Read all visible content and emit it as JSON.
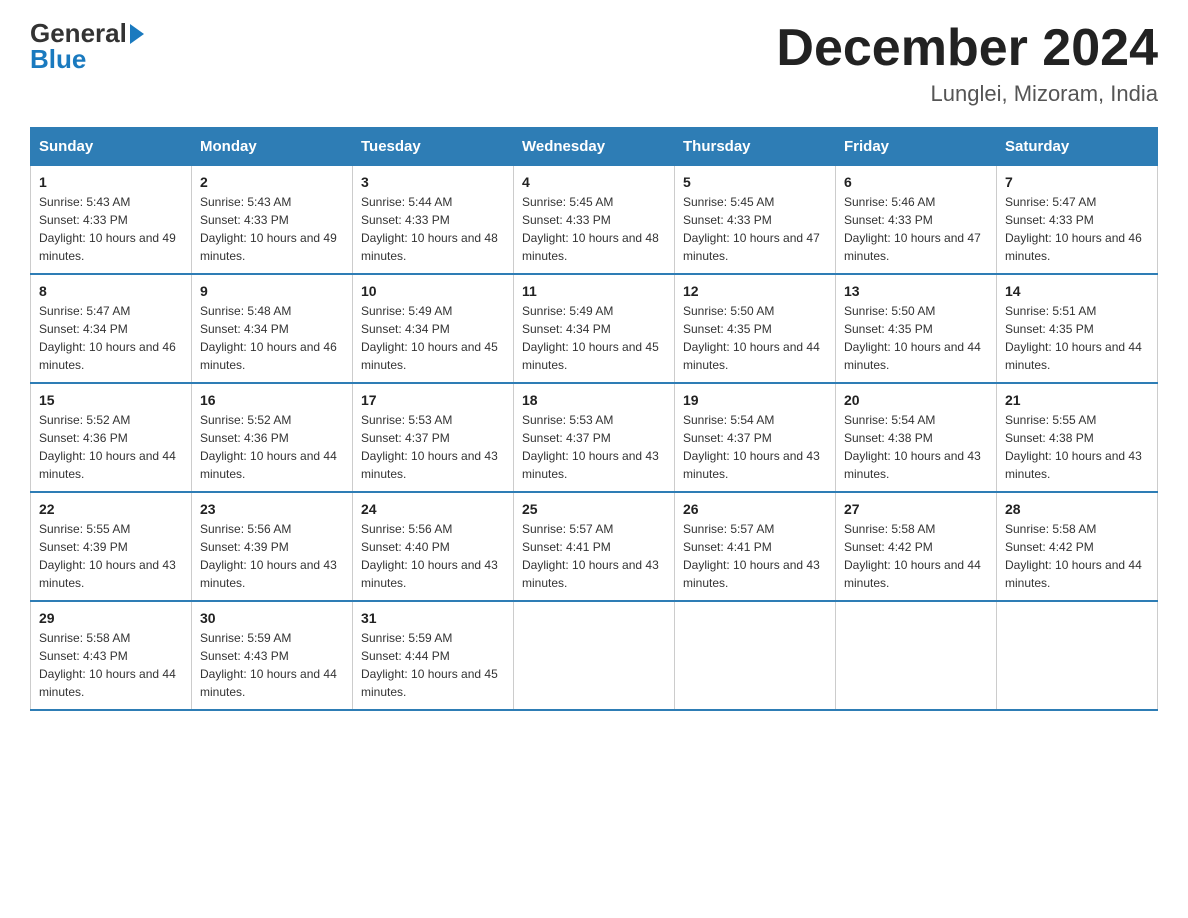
{
  "header": {
    "logo_general": "General",
    "logo_blue": "Blue",
    "month_title": "December 2024",
    "location": "Lunglei, Mizoram, India"
  },
  "weekdays": [
    "Sunday",
    "Monday",
    "Tuesday",
    "Wednesday",
    "Thursday",
    "Friday",
    "Saturday"
  ],
  "weeks": [
    [
      {
        "day": "1",
        "sunrise": "5:43 AM",
        "sunset": "4:33 PM",
        "daylight": "10 hours and 49 minutes."
      },
      {
        "day": "2",
        "sunrise": "5:43 AM",
        "sunset": "4:33 PM",
        "daylight": "10 hours and 49 minutes."
      },
      {
        "day": "3",
        "sunrise": "5:44 AM",
        "sunset": "4:33 PM",
        "daylight": "10 hours and 48 minutes."
      },
      {
        "day": "4",
        "sunrise": "5:45 AM",
        "sunset": "4:33 PM",
        "daylight": "10 hours and 48 minutes."
      },
      {
        "day": "5",
        "sunrise": "5:45 AM",
        "sunset": "4:33 PM",
        "daylight": "10 hours and 47 minutes."
      },
      {
        "day": "6",
        "sunrise": "5:46 AM",
        "sunset": "4:33 PM",
        "daylight": "10 hours and 47 minutes."
      },
      {
        "day": "7",
        "sunrise": "5:47 AM",
        "sunset": "4:33 PM",
        "daylight": "10 hours and 46 minutes."
      }
    ],
    [
      {
        "day": "8",
        "sunrise": "5:47 AM",
        "sunset": "4:34 PM",
        "daylight": "10 hours and 46 minutes."
      },
      {
        "day": "9",
        "sunrise": "5:48 AM",
        "sunset": "4:34 PM",
        "daylight": "10 hours and 46 minutes."
      },
      {
        "day": "10",
        "sunrise": "5:49 AM",
        "sunset": "4:34 PM",
        "daylight": "10 hours and 45 minutes."
      },
      {
        "day": "11",
        "sunrise": "5:49 AM",
        "sunset": "4:34 PM",
        "daylight": "10 hours and 45 minutes."
      },
      {
        "day": "12",
        "sunrise": "5:50 AM",
        "sunset": "4:35 PM",
        "daylight": "10 hours and 44 minutes."
      },
      {
        "day": "13",
        "sunrise": "5:50 AM",
        "sunset": "4:35 PM",
        "daylight": "10 hours and 44 minutes."
      },
      {
        "day": "14",
        "sunrise": "5:51 AM",
        "sunset": "4:35 PM",
        "daylight": "10 hours and 44 minutes."
      }
    ],
    [
      {
        "day": "15",
        "sunrise": "5:52 AM",
        "sunset": "4:36 PM",
        "daylight": "10 hours and 44 minutes."
      },
      {
        "day": "16",
        "sunrise": "5:52 AM",
        "sunset": "4:36 PM",
        "daylight": "10 hours and 44 minutes."
      },
      {
        "day": "17",
        "sunrise": "5:53 AM",
        "sunset": "4:37 PM",
        "daylight": "10 hours and 43 minutes."
      },
      {
        "day": "18",
        "sunrise": "5:53 AM",
        "sunset": "4:37 PM",
        "daylight": "10 hours and 43 minutes."
      },
      {
        "day": "19",
        "sunrise": "5:54 AM",
        "sunset": "4:37 PM",
        "daylight": "10 hours and 43 minutes."
      },
      {
        "day": "20",
        "sunrise": "5:54 AM",
        "sunset": "4:38 PM",
        "daylight": "10 hours and 43 minutes."
      },
      {
        "day": "21",
        "sunrise": "5:55 AM",
        "sunset": "4:38 PM",
        "daylight": "10 hours and 43 minutes."
      }
    ],
    [
      {
        "day": "22",
        "sunrise": "5:55 AM",
        "sunset": "4:39 PM",
        "daylight": "10 hours and 43 minutes."
      },
      {
        "day": "23",
        "sunrise": "5:56 AM",
        "sunset": "4:39 PM",
        "daylight": "10 hours and 43 minutes."
      },
      {
        "day": "24",
        "sunrise": "5:56 AM",
        "sunset": "4:40 PM",
        "daylight": "10 hours and 43 minutes."
      },
      {
        "day": "25",
        "sunrise": "5:57 AM",
        "sunset": "4:41 PM",
        "daylight": "10 hours and 43 minutes."
      },
      {
        "day": "26",
        "sunrise": "5:57 AM",
        "sunset": "4:41 PM",
        "daylight": "10 hours and 43 minutes."
      },
      {
        "day": "27",
        "sunrise": "5:58 AM",
        "sunset": "4:42 PM",
        "daylight": "10 hours and 44 minutes."
      },
      {
        "day": "28",
        "sunrise": "5:58 AM",
        "sunset": "4:42 PM",
        "daylight": "10 hours and 44 minutes."
      }
    ],
    [
      {
        "day": "29",
        "sunrise": "5:58 AM",
        "sunset": "4:43 PM",
        "daylight": "10 hours and 44 minutes."
      },
      {
        "day": "30",
        "sunrise": "5:59 AM",
        "sunset": "4:43 PM",
        "daylight": "10 hours and 44 minutes."
      },
      {
        "day": "31",
        "sunrise": "5:59 AM",
        "sunset": "4:44 PM",
        "daylight": "10 hours and 45 minutes."
      },
      null,
      null,
      null,
      null
    ]
  ]
}
